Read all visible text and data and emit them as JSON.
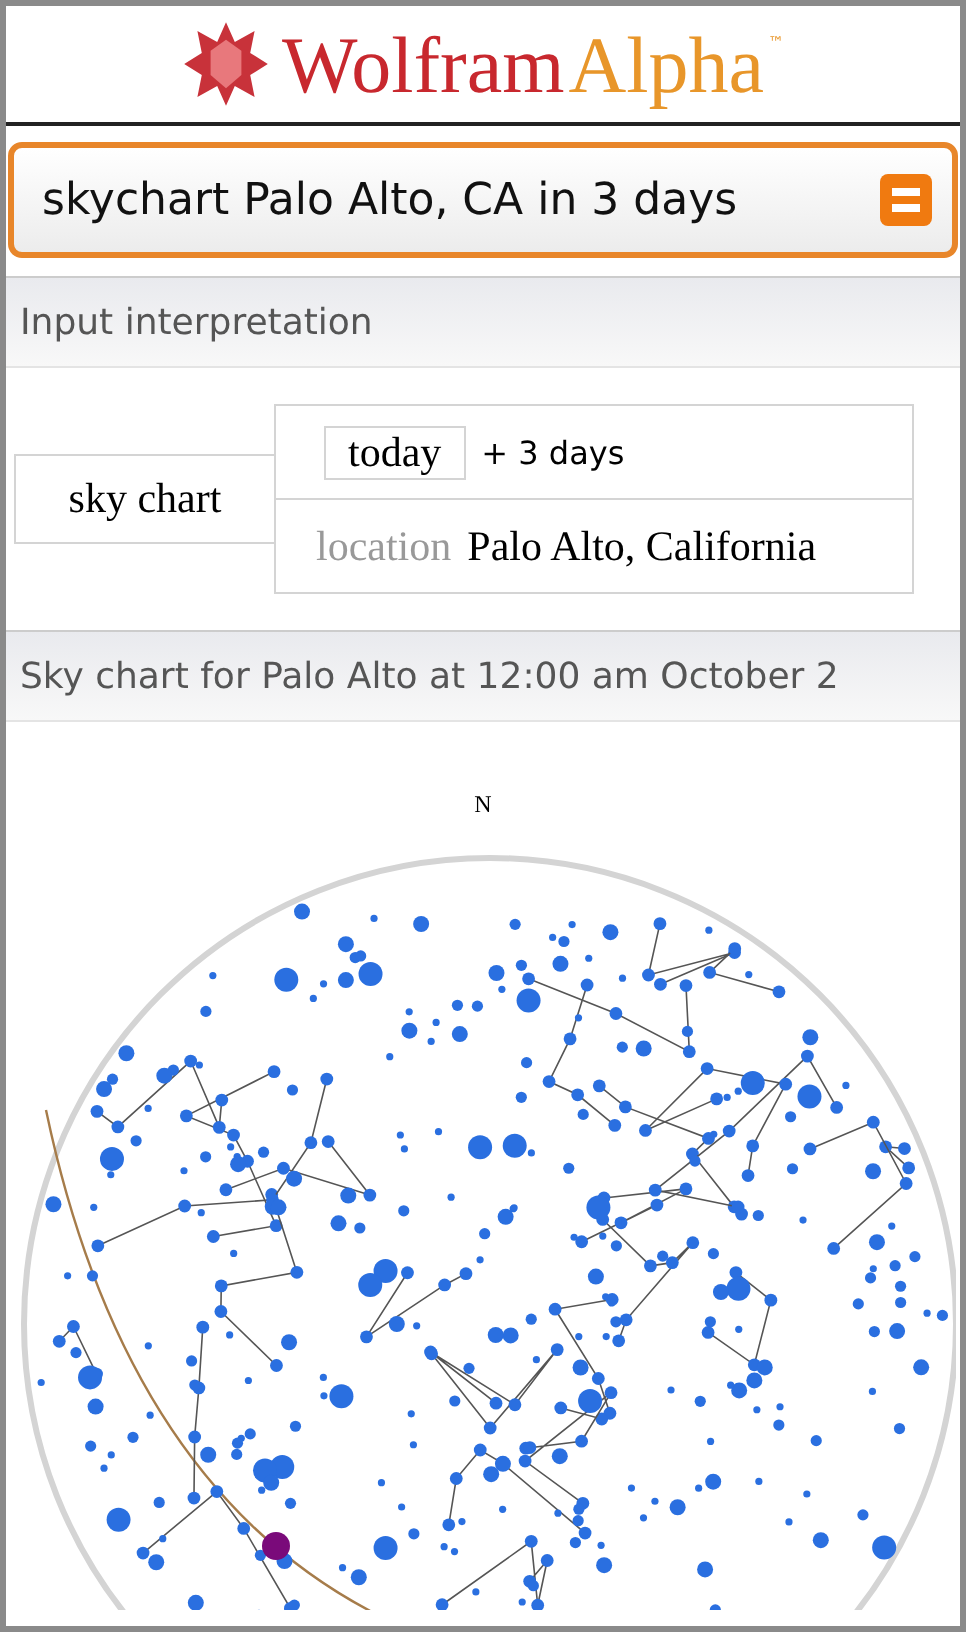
{
  "logo": {
    "brand_part1": "Wolfram",
    "brand_part2": "Alpha",
    "trademark": "™"
  },
  "search": {
    "value": "skychart Palo Alto, CA in 3 days"
  },
  "input_interpretation": {
    "title": "Input interpretation",
    "main": "sky chart",
    "rows": [
      {
        "kind": "date",
        "label": "today",
        "value": "+ 3 days"
      },
      {
        "kind": "location",
        "label": "location",
        "value": "Palo Alto, California"
      }
    ]
  },
  "sky_chart": {
    "title": "Sky chart for Palo Alto at 12:00 am October 2",
    "compass": "N"
  }
}
